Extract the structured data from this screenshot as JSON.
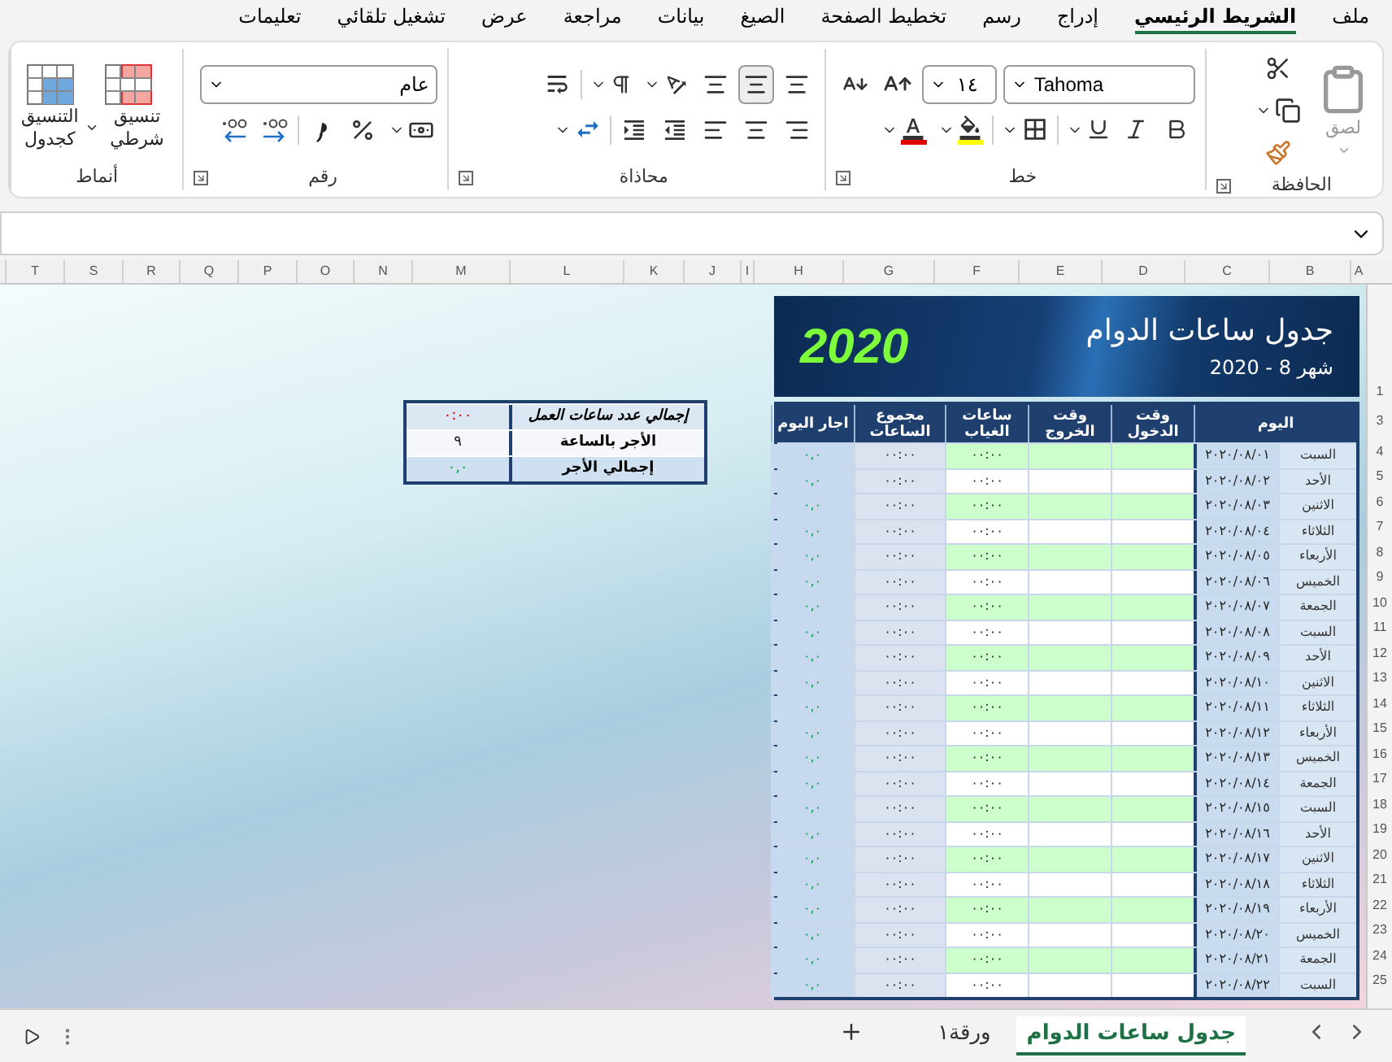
{
  "ribbon_tabs": [
    {
      "label": "ملف",
      "selected": false
    },
    {
      "label": "الشريط الرئيسي",
      "selected": true
    },
    {
      "label": "إدراج",
      "selected": false
    },
    {
      "label": "رسم",
      "selected": false
    },
    {
      "label": "تخطيط الصفحة",
      "selected": false
    },
    {
      "label": "الصيغ",
      "selected": false
    },
    {
      "label": "بيانات",
      "selected": false
    },
    {
      "label": "مراجعة",
      "selected": false
    },
    {
      "label": "عرض",
      "selected": false
    },
    {
      "label": "تشغيل تلقائي",
      "selected": false
    },
    {
      "label": "تعليمات",
      "selected": false
    }
  ],
  "ribbon": {
    "clipboard": {
      "label": "الحافظة",
      "paste": "لصق"
    },
    "font": {
      "label": "خط",
      "font_name": "Tahoma",
      "font_size": "١٤"
    },
    "alignment": {
      "label": "محاذاة"
    },
    "number": {
      "label": "رقم",
      "format": "عام"
    },
    "styles": {
      "label": "أنماط",
      "conditional": "تنسيق شرطي",
      "as_table": "التنسيق كجدول"
    }
  },
  "column_headers": [
    "A",
    "B",
    "C",
    "D",
    "E",
    "F",
    "G",
    "H",
    "I",
    "J",
    "K",
    "L",
    "M",
    "N",
    "O",
    "P",
    "Q",
    "R",
    "S",
    "T"
  ],
  "row_numbers": [
    "1",
    "3",
    "4",
    "5",
    "6",
    "7",
    "8",
    "9",
    "10",
    "11",
    "12",
    "13",
    "14",
    "15",
    "16",
    "17",
    "18",
    "19",
    "20",
    "21",
    "22",
    "23",
    "24",
    "25"
  ],
  "schedule": {
    "title": "جدول ساعات الدوام",
    "subtitle": "شهر 8 - 2020",
    "year": "2020",
    "columns": [
      "اليوم",
      "وقت الدخول",
      "وقت الخروج",
      "ساعات الغياب",
      "مجموع الساعات",
      "اجار اليوم"
    ],
    "rows": [
      {
        "day": "السبت",
        "date": "٢٠٢٠/٠٨/٠١",
        "absence": "٠٠:٠٠",
        "total": "٠٠:٠٠",
        "wage": "٠,٠",
        "highlighted": true
      },
      {
        "day": "الأحد",
        "date": "٢٠٢٠/٠٨/٠٢",
        "absence": "٠٠:٠٠",
        "total": "٠٠:٠٠",
        "wage": "٠,٠",
        "highlighted": false
      },
      {
        "day": "الاثنين",
        "date": "٢٠٢٠/٠٨/٠٣",
        "absence": "٠٠:٠٠",
        "total": "٠٠:٠٠",
        "wage": "٠,٠",
        "highlighted": true
      },
      {
        "day": "الثلاثاء",
        "date": "٢٠٢٠/٠٨/٠٤",
        "absence": "٠٠:٠٠",
        "total": "٠٠:٠٠",
        "wage": "٠,٠",
        "highlighted": false
      },
      {
        "day": "الأربعاء",
        "date": "٢٠٢٠/٠٨/٠٥",
        "absence": "٠٠:٠٠",
        "total": "٠٠:٠٠",
        "wage": "٠,٠",
        "highlighted": true
      },
      {
        "day": "الخميس",
        "date": "٢٠٢٠/٠٨/٠٦",
        "absence": "٠٠:٠٠",
        "total": "٠٠:٠٠",
        "wage": "٠,٠",
        "highlighted": false
      },
      {
        "day": "الجمعة",
        "date": "٢٠٢٠/٠٨/٠٧",
        "absence": "٠٠:٠٠",
        "total": "٠٠:٠٠",
        "wage": "٠,٠",
        "highlighted": true
      },
      {
        "day": "السبت",
        "date": "٢٠٢٠/٠٨/٠٨",
        "absence": "٠٠:٠٠",
        "total": "٠٠:٠٠",
        "wage": "٠,٠",
        "highlighted": false
      },
      {
        "day": "الأحد",
        "date": "٢٠٢٠/٠٨/٠٩",
        "absence": "٠٠:٠٠",
        "total": "٠٠:٠٠",
        "wage": "٠,٠",
        "highlighted": true
      },
      {
        "day": "الاثنين",
        "date": "٢٠٢٠/٠٨/١٠",
        "absence": "٠٠:٠٠",
        "total": "٠٠:٠٠",
        "wage": "٠,٠",
        "highlighted": false
      },
      {
        "day": "الثلاثاء",
        "date": "٢٠٢٠/٠٨/١١",
        "absence": "٠٠:٠٠",
        "total": "٠٠:٠٠",
        "wage": "٠,٠",
        "highlighted": true
      },
      {
        "day": "الأربعاء",
        "date": "٢٠٢٠/٠٨/١٢",
        "absence": "٠٠:٠٠",
        "total": "٠٠:٠٠",
        "wage": "٠,٠",
        "highlighted": false
      },
      {
        "day": "الخميس",
        "date": "٢٠٢٠/٠٨/١٣",
        "absence": "٠٠:٠٠",
        "total": "٠٠:٠٠",
        "wage": "٠,٠",
        "highlighted": true
      },
      {
        "day": "الجمعة",
        "date": "٢٠٢٠/٠٨/١٤",
        "absence": "٠٠:٠٠",
        "total": "٠٠:٠٠",
        "wage": "٠,٠",
        "highlighted": false
      },
      {
        "day": "السبت",
        "date": "٢٠٢٠/٠٨/١٥",
        "absence": "٠٠:٠٠",
        "total": "٠٠:٠٠",
        "wage": "٠,٠",
        "highlighted": true
      },
      {
        "day": "الأحد",
        "date": "٢٠٢٠/٠٨/١٦",
        "absence": "٠٠:٠٠",
        "total": "٠٠:٠٠",
        "wage": "٠,٠",
        "highlighted": false
      },
      {
        "day": "الاثنين",
        "date": "٢٠٢٠/٠٨/١٧",
        "absence": "٠٠:٠٠",
        "total": "٠٠:٠٠",
        "wage": "٠,٠",
        "highlighted": true
      },
      {
        "day": "الثلاثاء",
        "date": "٢٠٢٠/٠٨/١٨",
        "absence": "٠٠:٠٠",
        "total": "٠٠:٠٠",
        "wage": "٠,٠",
        "highlighted": false
      },
      {
        "day": "الأربعاء",
        "date": "٢٠٢٠/٠٨/١٩",
        "absence": "٠٠:٠٠",
        "total": "٠٠:٠٠",
        "wage": "٠,٠",
        "highlighted": true
      },
      {
        "day": "الخميس",
        "date": "٢٠٢٠/٠٨/٢٠",
        "absence": "٠٠:٠٠",
        "total": "٠٠:٠٠",
        "wage": "٠,٠",
        "highlighted": false
      },
      {
        "day": "الجمعة",
        "date": "٢٠٢٠/٠٨/٢١",
        "absence": "٠٠:٠٠",
        "total": "٠٠:٠٠",
        "wage": "٠,٠",
        "highlighted": true
      },
      {
        "day": "السبت",
        "date": "٢٠٢٠/٠٨/٢٢",
        "absence": "٠٠:٠٠",
        "total": "٠٠:٠٠",
        "wage": "٠,٠",
        "highlighted": false
      }
    ]
  },
  "summary": [
    {
      "label": "إجمالي عدد ساعات العمل",
      "value": "٠:٠٠",
      "kind": "hours"
    },
    {
      "label": "الأجر بالساعة",
      "value": "٩",
      "kind": "rate"
    },
    {
      "label": "إجمالي الأجر",
      "value": "٠,٠",
      "kind": "total"
    }
  ],
  "sheet_tabs": [
    {
      "label": "جدول ساعات الدوام",
      "selected": true
    },
    {
      "label": "ورقة١",
      "selected": false
    }
  ]
}
